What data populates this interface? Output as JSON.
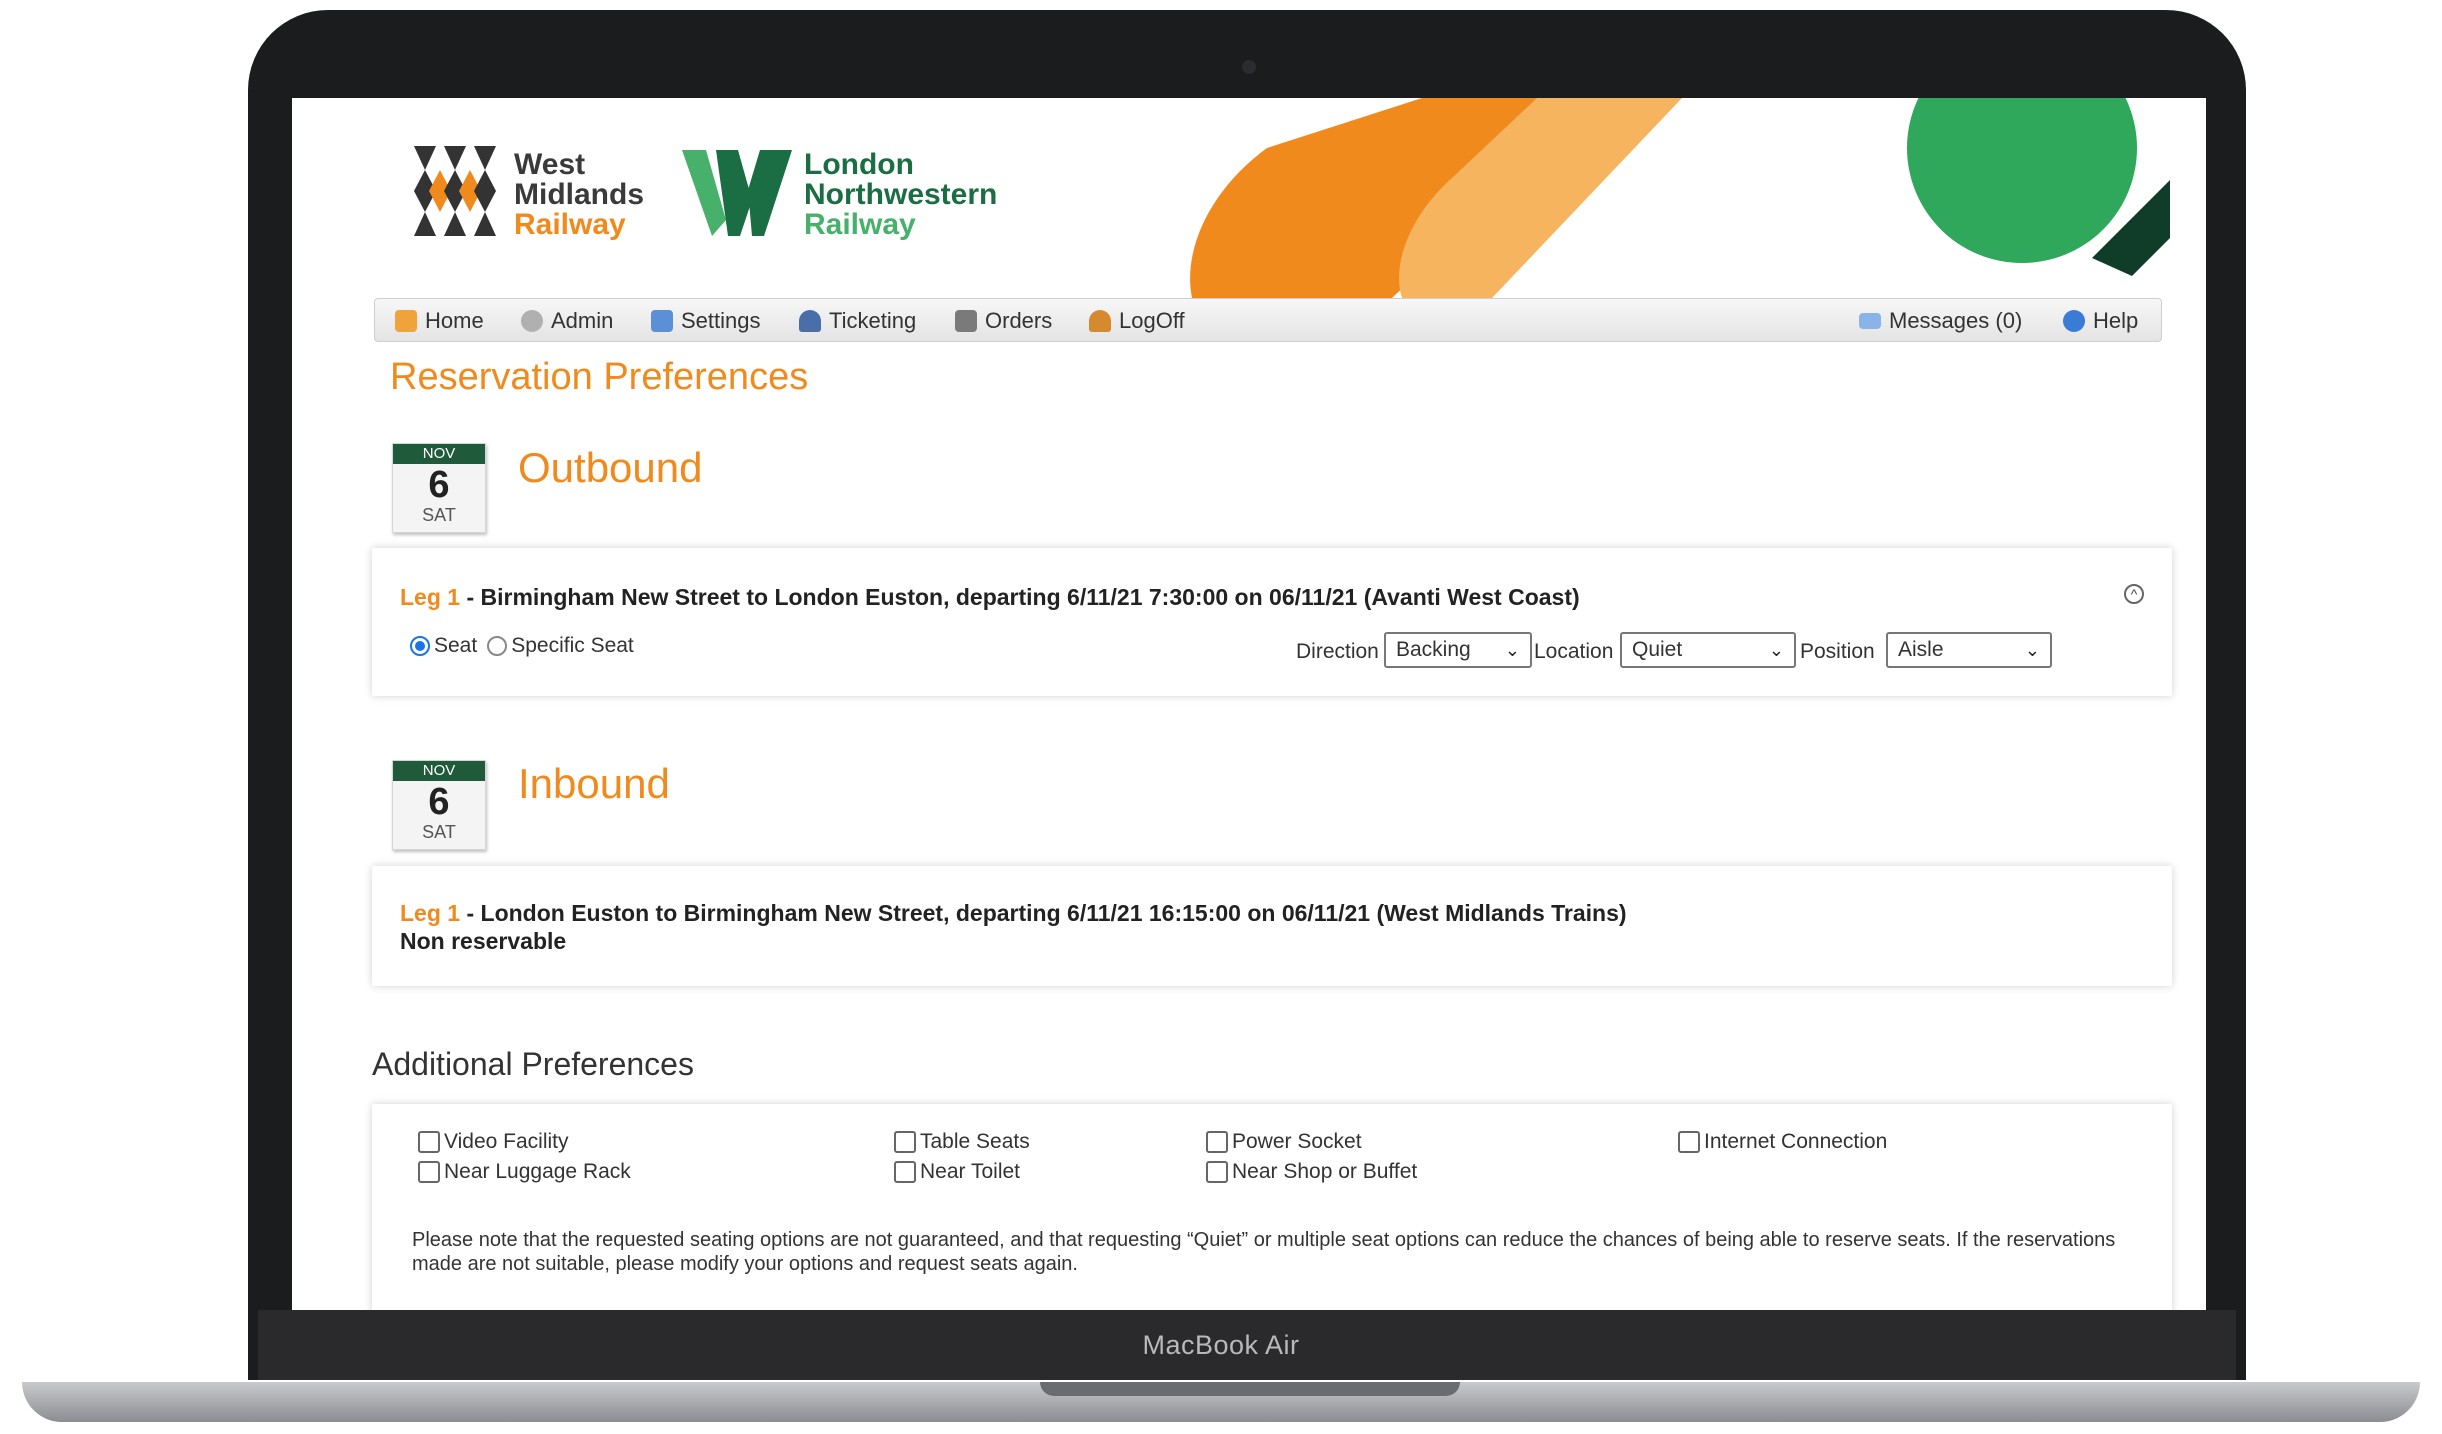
{
  "header": {
    "wmr_logo": {
      "line1": "West",
      "line2": "Midlands",
      "line3": "Railway"
    },
    "lnr_logo": {
      "line1": "London",
      "line2": "Northwestern",
      "line3": "Railway"
    }
  },
  "nav": {
    "left": [
      {
        "label": "Home",
        "icon": "home-icon"
      },
      {
        "label": "Admin",
        "icon": "gear-icon"
      },
      {
        "label": "Settings",
        "icon": "settings-icon"
      },
      {
        "label": "Ticketing",
        "icon": "user-icon"
      },
      {
        "label": "Orders",
        "icon": "building-icon"
      },
      {
        "label": "LogOff",
        "icon": "logoff-icon"
      }
    ],
    "right": [
      {
        "label": "Messages (0)",
        "icon": "envelope-icon"
      },
      {
        "label": "Help",
        "icon": "help-icon"
      }
    ]
  },
  "page": {
    "title": "Reservation Preferences",
    "outbound": {
      "heading": "Outbound",
      "date": {
        "month": "NOV",
        "day": "6",
        "dow": "SAT"
      },
      "leg_prefix": "Leg 1",
      "leg_text": " - Birmingham New Street to London Euston, departing 6/11/21 7:30:00 on 06/11/21 (Avanti West Coast)",
      "seat_label": "Seat",
      "specific_seat_label": "Specific Seat",
      "direction_label": "Direction",
      "direction_value": "Backing",
      "location_label": "Location",
      "location_value": "Quiet",
      "position_label": "Position",
      "position_value": "Aisle"
    },
    "inbound": {
      "heading": "Inbound",
      "date": {
        "month": "NOV",
        "day": "6",
        "dow": "SAT"
      },
      "leg_prefix": "Leg 1",
      "leg_text": " - London Euston to Birmingham New Street, departing 6/11/21 16:15:00 on 06/11/21 (West Midlands Trains)",
      "status": "Non reservable"
    },
    "additional": {
      "heading": "Additional Preferences",
      "options": [
        "Video Facility",
        "Table Seats",
        "Power Socket",
        "Internet Connection",
        "Near Luggage Rack",
        "Near Toilet",
        "Near Shop or Buffet"
      ],
      "note": "Please note that the requested seating options are not guaranteed, and that requesting “Quiet” or multiple seat options can reduce the chances of being able to reserve seats. If the reservations made are not suitable, please modify your options and request seats again."
    }
  },
  "device": {
    "model": "MacBook Air"
  },
  "colors": {
    "accent": "#f08a1c",
    "green": "#1f5b3b"
  }
}
